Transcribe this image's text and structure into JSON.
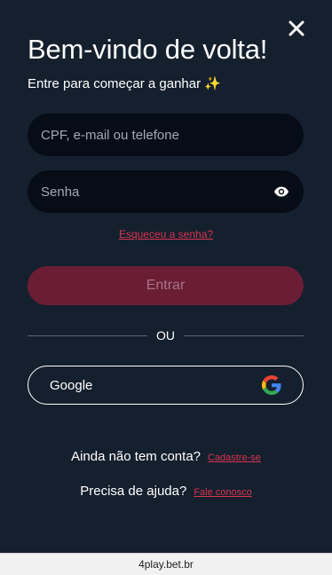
{
  "modal": {
    "title": "Bem-vindo de volta!",
    "subtitle": "Entre para começar a ganhar ✨",
    "close_icon": "close-icon"
  },
  "form": {
    "username_placeholder": "CPF, e-mail ou telefone",
    "username_value": "",
    "password_placeholder": "Senha",
    "password_value": "",
    "password_toggle_icon": "eye-icon",
    "forgot_label": "Esqueceu a senha?",
    "submit_label": "Entrar"
  },
  "divider": {
    "label": "OU"
  },
  "social": {
    "google_label": "Google",
    "google_icon": "google-icon"
  },
  "footer": {
    "signup_question": "Ainda não tem conta?",
    "signup_link": "Cadastre-se",
    "help_question": "Precisa de ajuda?",
    "help_link": "Fale conosco"
  },
  "browser": {
    "url": "4play.bet.br"
  },
  "colors": {
    "background": "#15202e",
    "input_background": "#060d16",
    "accent": "#d8344f",
    "button_disabled": "#6b1d36"
  }
}
